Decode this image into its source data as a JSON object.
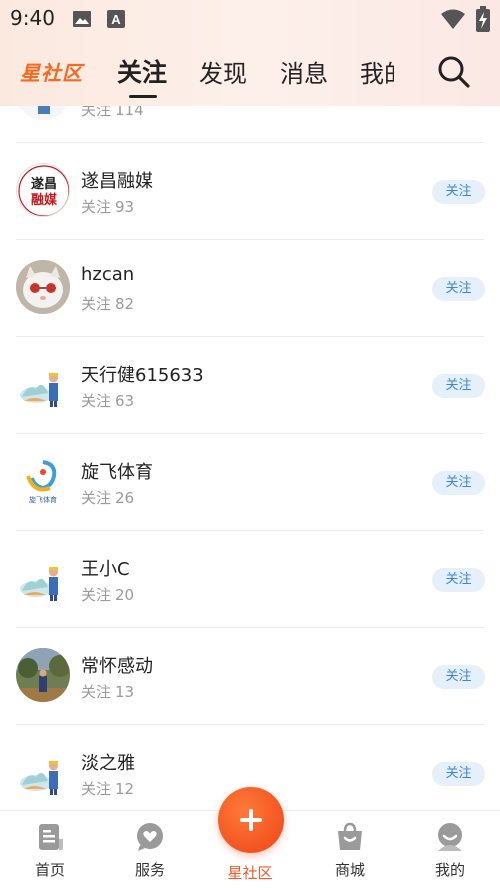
{
  "status_bar": {
    "time": "9:40",
    "icons": [
      "image-icon",
      "a-box-icon",
      "wifi-icon",
      "battery-charging-icon"
    ]
  },
  "header": {
    "logo": "星社区",
    "tabs": [
      {
        "label": "关注",
        "active": true
      },
      {
        "label": "发现",
        "active": false
      },
      {
        "label": "消息",
        "active": false
      },
      {
        "label": "我的",
        "active": false
      }
    ],
    "search_icon": "search-icon"
  },
  "partial_row": {
    "count_label": "关注",
    "count": "114"
  },
  "list": [
    {
      "name": "遂昌融媒",
      "count_label": "关注",
      "count": "93",
      "button": "关注",
      "avatar": "logo-suichang"
    },
    {
      "name": "hzcan",
      "count_label": "关注",
      "count": "82",
      "button": "关注",
      "avatar": "cat-photo"
    },
    {
      "name": "天行健615633",
      "count_label": "关注",
      "count": "63",
      "button": "关注",
      "avatar": "default-illustration"
    },
    {
      "name": "旋飞体育",
      "count_label": "关注",
      "count": "26",
      "button": "关注",
      "avatar": "sports-logo"
    },
    {
      "name": "王小C",
      "count_label": "关注",
      "count": "20",
      "button": "关注",
      "avatar": "default-illustration"
    },
    {
      "name": "常怀感动",
      "count_label": "关注",
      "count": "13",
      "button": "关注",
      "avatar": "person-photo"
    },
    {
      "name": "淡之雅",
      "count_label": "关注",
      "count": "12",
      "button": "关注",
      "avatar": "default-illustration"
    }
  ],
  "bottom_nav": [
    {
      "label": "首页",
      "icon": "home-doc-icon",
      "active": false
    },
    {
      "label": "服务",
      "icon": "heart-bubble-icon",
      "active": false
    },
    {
      "label": "星社区",
      "icon": "plus-icon",
      "active": true
    },
    {
      "label": "商城",
      "icon": "shopping-bag-icon",
      "active": false
    },
    {
      "label": "我的",
      "icon": "profile-icon",
      "active": false
    }
  ],
  "colors": {
    "accent": "#f05a28",
    "follow_bg": "#e5f0fb",
    "follow_text": "#3b86d8",
    "muted_text": "#9a9a9a"
  }
}
